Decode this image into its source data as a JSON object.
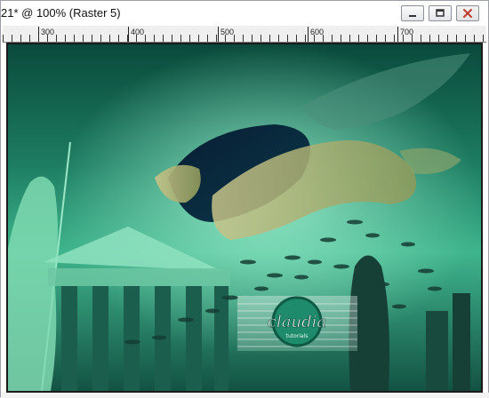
{
  "window": {
    "title": "21* @ 100% (Raster 5)",
    "buttons": [
      "minimize",
      "maximize",
      "close"
    ]
  },
  "ruler": {
    "labels": [
      "300",
      "400",
      "500",
      "600",
      "700"
    ]
  },
  "watermark": {
    "text": "claudia",
    "subtext": "tutorials"
  },
  "colors": {
    "canvas_dark": "#06352c",
    "canvas_mid": "#1f8e6b",
    "canvas_light": "#7fe0b9",
    "ruler_bg": "#efefef",
    "close_x": "#c0392b"
  }
}
